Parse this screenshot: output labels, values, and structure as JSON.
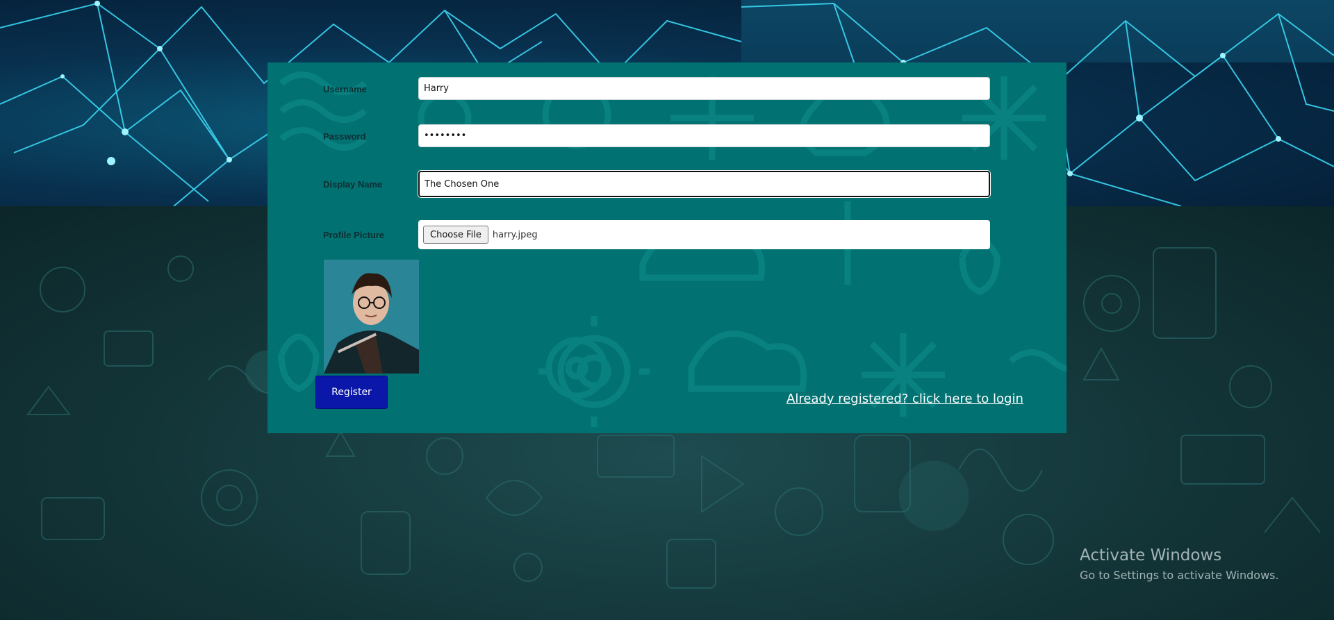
{
  "form": {
    "username_label": "Username",
    "username_value": "Harry",
    "password_label": "Password",
    "password_value": "harrypot",
    "display_name_label": "Display Name",
    "display_name_value": "The Chosen One",
    "profile_picture_label": "Profile Picture",
    "choose_file_label": "Choose File",
    "file_name": "harry.jpeg",
    "register_label": "Register",
    "login_link": "Already registered? click here to login"
  },
  "watermark": {
    "title": "Activate Windows",
    "subtitle": "Go to Settings to activate Windows."
  },
  "colors": {
    "panel": "#027171",
    "register_button": "#0a17a8",
    "banner_lines": "#3ad6f2"
  }
}
